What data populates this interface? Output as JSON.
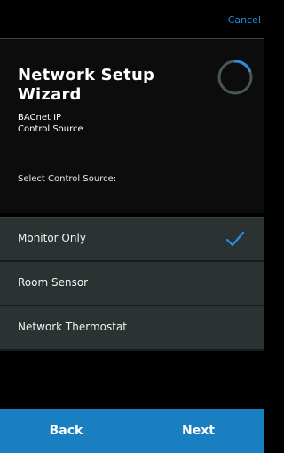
{
  "topbar": {
    "cancel_label": "Cancel"
  },
  "header": {
    "title_line1": "Network Setup",
    "title_line2": "Wizard",
    "subtitle_line1": "BACnet IP",
    "subtitle_line2": "Control Source"
  },
  "prompt": "Select Control Source:",
  "options": [
    {
      "label": "Monitor Only",
      "selected": true
    },
    {
      "label": "Room Sensor",
      "selected": false
    },
    {
      "label": "Network Thermostat",
      "selected": false
    }
  ],
  "footer": {
    "back_label": "Back",
    "next_label": "Next"
  },
  "colors": {
    "accent": "#1a7fc0",
    "cancel_text": "#1a8fd6",
    "check": "#2a8ee0",
    "background": "#000000",
    "option_background": "#2a3232"
  },
  "icons": {
    "spinner": "loading-spinner-icon",
    "check": "checkmark-icon"
  }
}
